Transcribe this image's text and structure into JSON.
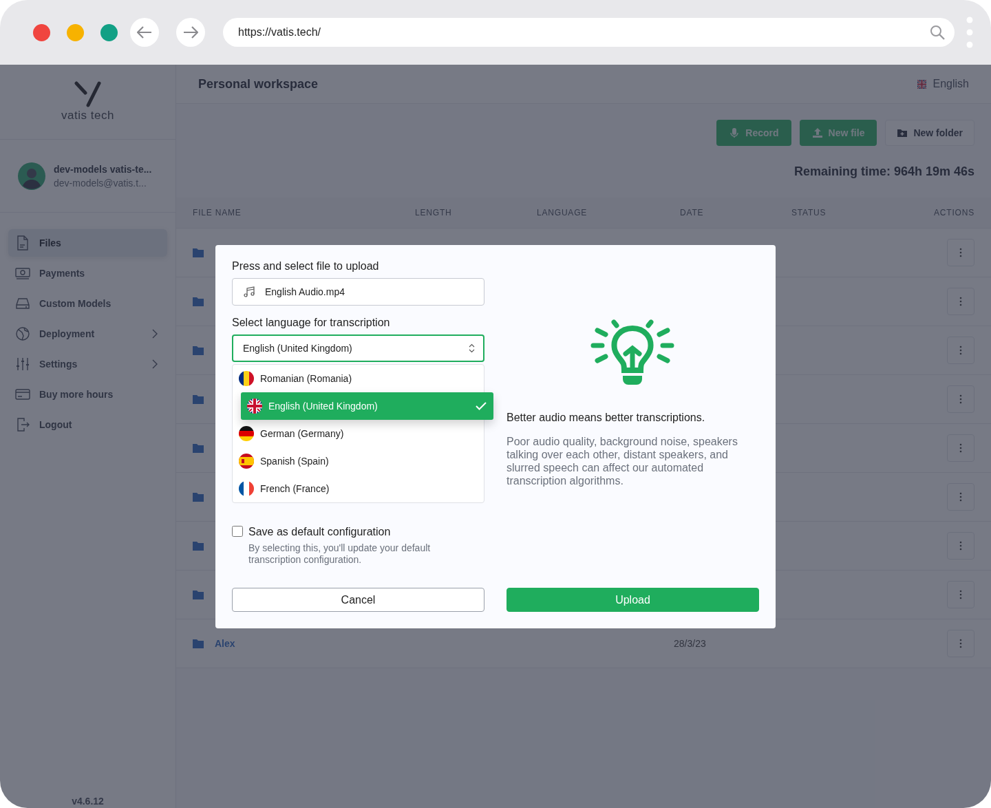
{
  "browser": {
    "url": "https://vatis.tech/"
  },
  "sidebar": {
    "logo_text": "vatis tech",
    "user": {
      "name": "dev-models vatis-te...",
      "email": "dev-models@vatis.t..."
    },
    "items": [
      {
        "label": "Files",
        "selected": true,
        "has_submenu": false
      },
      {
        "label": "Payments",
        "selected": false,
        "has_submenu": false
      },
      {
        "label": "Custom Models",
        "selected": false,
        "has_submenu": false
      },
      {
        "label": "Deployment",
        "selected": false,
        "has_submenu": true
      },
      {
        "label": "Settings",
        "selected": false,
        "has_submenu": true
      },
      {
        "label": "Buy more hours",
        "selected": false,
        "has_submenu": false
      },
      {
        "label": "Logout",
        "selected": false,
        "has_submenu": false
      }
    ],
    "version": "v4.6.12"
  },
  "header": {
    "title": "Personal workspace",
    "language": "English"
  },
  "toolbar": {
    "buttons": [
      {
        "label": "Record",
        "kind": "primary"
      },
      {
        "label": "New file",
        "kind": "primary"
      },
      {
        "label": "New folder",
        "kind": "secondary"
      }
    ]
  },
  "remaining_time": "Remaining time: 964h 19m 46s",
  "table": {
    "columns": [
      "FILE NAME",
      "LENGTH",
      "LANGUAGE",
      "DATE",
      "STATUS",
      "ACTIONS"
    ],
    "rows": [
      {
        "kind": "folder"
      },
      {
        "kind": "folder"
      },
      {
        "kind": "folder"
      },
      {
        "kind": "folder"
      },
      {
        "kind": "folder"
      },
      {
        "kind": "folder"
      },
      {
        "kind": "folder"
      },
      {
        "kind": "folder"
      },
      {
        "kind": "folder",
        "name": "Alex",
        "date": "28/3/23"
      }
    ]
  },
  "dialog": {
    "file_label": "Press and select file to upload",
    "file_name": "English Audio.mp4",
    "language_label": "Select language for transcription",
    "language_value": "English (United Kingdom)",
    "options": [
      {
        "label": "Romanian (Romania)",
        "kind": "ro",
        "selected": false
      },
      {
        "label": "English (United Kingdom)",
        "kind": "gb",
        "selected": true
      },
      {
        "label": "German (Germany)",
        "kind": "de",
        "selected": false
      },
      {
        "label": "Spanish (Spain)",
        "kind": "es",
        "selected": false
      },
      {
        "label": "French (France)",
        "kind": "fr",
        "selected": false
      }
    ],
    "save_default": {
      "label": "Save as default configuration",
      "hint": "By selecting this, you'll update your default transcription configuration.",
      "checked": false
    },
    "tip_title": "Better audio means better transcriptions.",
    "tip_text": "Poor audio quality, background noise, speakers talking over each other, distant speakers, and slurred speech can affect our automated transcription algorithms.",
    "buttons": [
      {
        "label": "Cancel",
        "kind": "secondary"
      },
      {
        "label": "Upload",
        "kind": "primary"
      }
    ]
  }
}
